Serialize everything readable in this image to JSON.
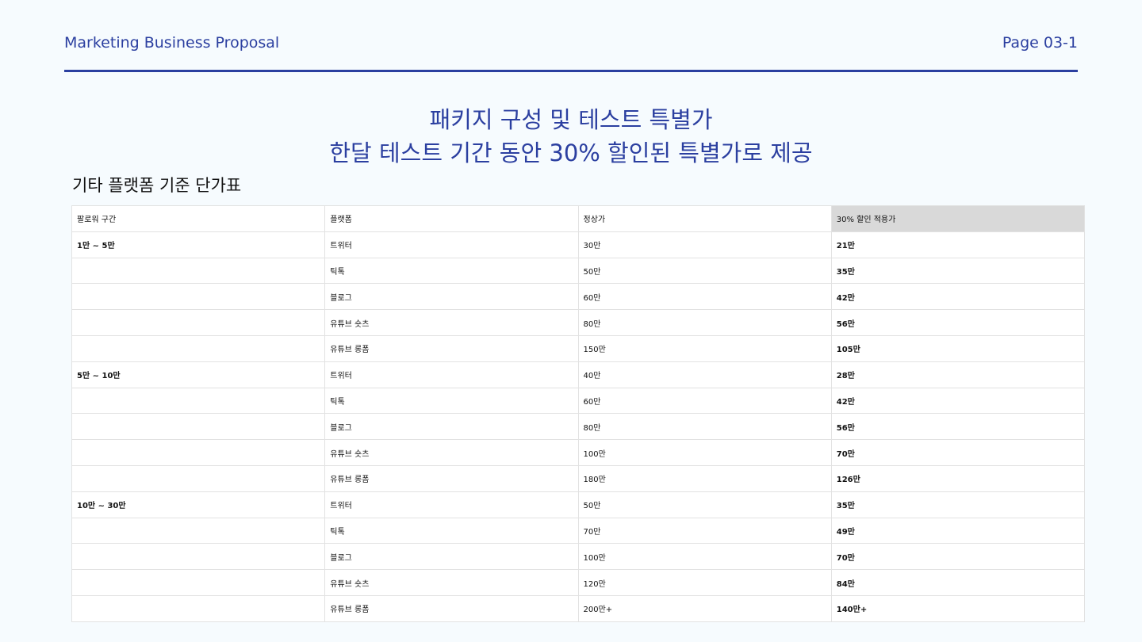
{
  "header": {
    "title": "Marketing Business Proposal",
    "page": "Page 03-1"
  },
  "headline": {
    "line1": "패키지 구성 및 테스트 특별가",
    "line2": "한달 테스트 기간 동안 30% 할인된 특별가로 제공"
  },
  "section_title": "기타 플랫폼 기준 단가표",
  "table": {
    "columns": [
      "팔로워 구간",
      "플랫폼",
      "정상가",
      "30% 할인 적용가"
    ],
    "rows": [
      {
        "tier": "1만 ~ 5만",
        "platform": "트위터",
        "regular": "30만",
        "discounted": "21만"
      },
      {
        "tier": "",
        "platform": "틱톡",
        "regular": "50만",
        "discounted": "35만"
      },
      {
        "tier": "",
        "platform": "블로그",
        "regular": "60만",
        "discounted": "42만"
      },
      {
        "tier": "",
        "platform": "유튜브 숏츠",
        "regular": "80만",
        "discounted": "56만"
      },
      {
        "tier": "",
        "platform": "유튜브 롱폼",
        "regular": "150만",
        "discounted": "105만"
      },
      {
        "tier": "5만 ~ 10만",
        "platform": "트위터",
        "regular": "40만",
        "discounted": "28만"
      },
      {
        "tier": "",
        "platform": "틱톡",
        "regular": "60만",
        "discounted": "42만"
      },
      {
        "tier": "",
        "platform": "블로그",
        "regular": "80만",
        "discounted": "56만"
      },
      {
        "tier": "",
        "platform": "유튜브 숏츠",
        "regular": "100만",
        "discounted": "70만"
      },
      {
        "tier": "",
        "platform": "유튜브 롱폼",
        "regular": "180만",
        "discounted": "126만"
      },
      {
        "tier": "10만 ~ 30만",
        "platform": "트위터",
        "regular": "50만",
        "discounted": "35만"
      },
      {
        "tier": "",
        "platform": "틱톡",
        "regular": "70만",
        "discounted": "49만"
      },
      {
        "tier": "",
        "platform": "블로그",
        "regular": "100만",
        "discounted": "70만"
      },
      {
        "tier": "",
        "platform": "유튜브 숏츠",
        "regular": "120만",
        "discounted": "84만"
      },
      {
        "tier": "",
        "platform": "유튜브 롱폼",
        "regular": "200만+",
        "discounted": "140만+"
      }
    ]
  },
  "colors": {
    "accent": "#2b3fa0",
    "background": "#f6fbfe",
    "highlight_header": "#d9d9d9"
  }
}
